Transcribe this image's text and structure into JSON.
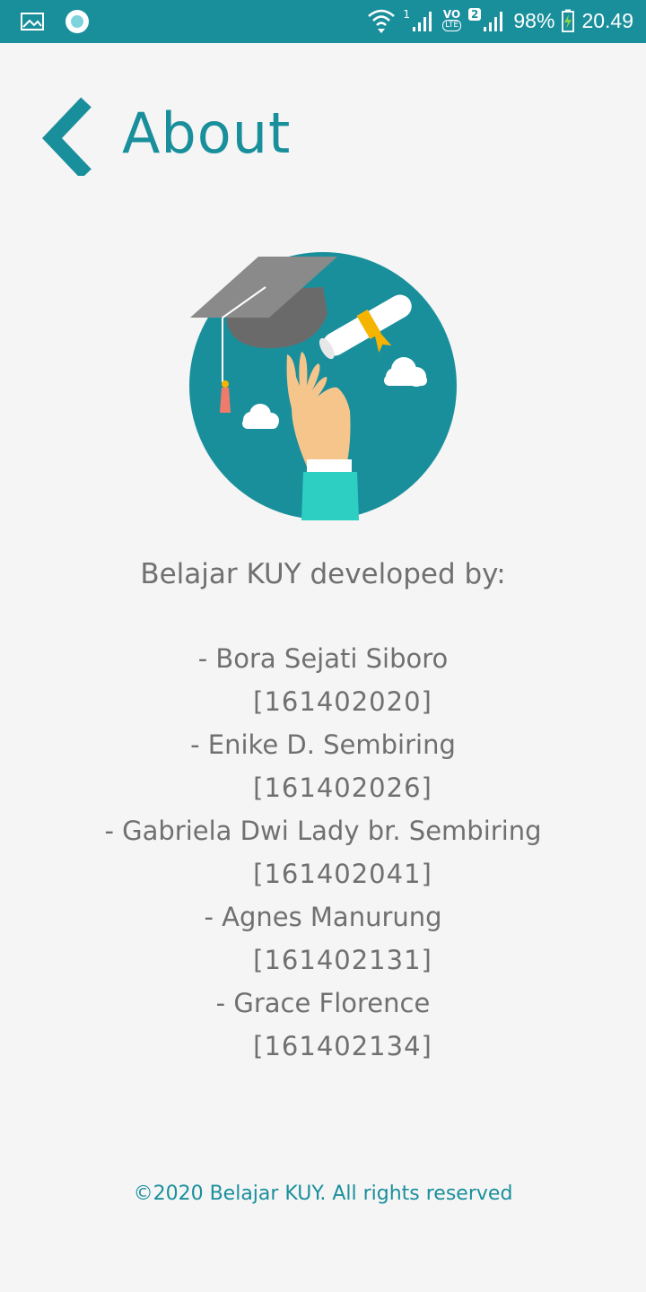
{
  "statusbar": {
    "left_icons": [
      "image-icon",
      "circle-notification-icon"
    ],
    "sim1_label": "1",
    "volte_label": "VO",
    "lte_label": "LTE",
    "sim2_label": "2",
    "battery": "98%",
    "time": "20.49"
  },
  "header": {
    "back_icon": "chevron-left-icon",
    "title": "About"
  },
  "illustration": {
    "name": "graduation-illustration"
  },
  "credits": {
    "heading": "Belajar KUY developed by:",
    "developers": [
      {
        "name": "- Bora Sejati Siboro",
        "nim": "[161402020]"
      },
      {
        "name": "- Enike D. Sembiring",
        "nim": "[161402026]"
      },
      {
        "name": "- Gabriela Dwi Lady br. Sembiring",
        "nim": "[161402041]"
      },
      {
        "name": "- Agnes Manurung",
        "nim": "[161402131]"
      },
      {
        "name": "- Grace Florence",
        "nim": "[161402134]"
      }
    ]
  },
  "footer": {
    "text": "©2020 Belajar KUY. All rights reserved"
  },
  "colors": {
    "accent": "#1a8f9c",
    "text_gray": "#707070",
    "background": "#f5f5f5"
  }
}
